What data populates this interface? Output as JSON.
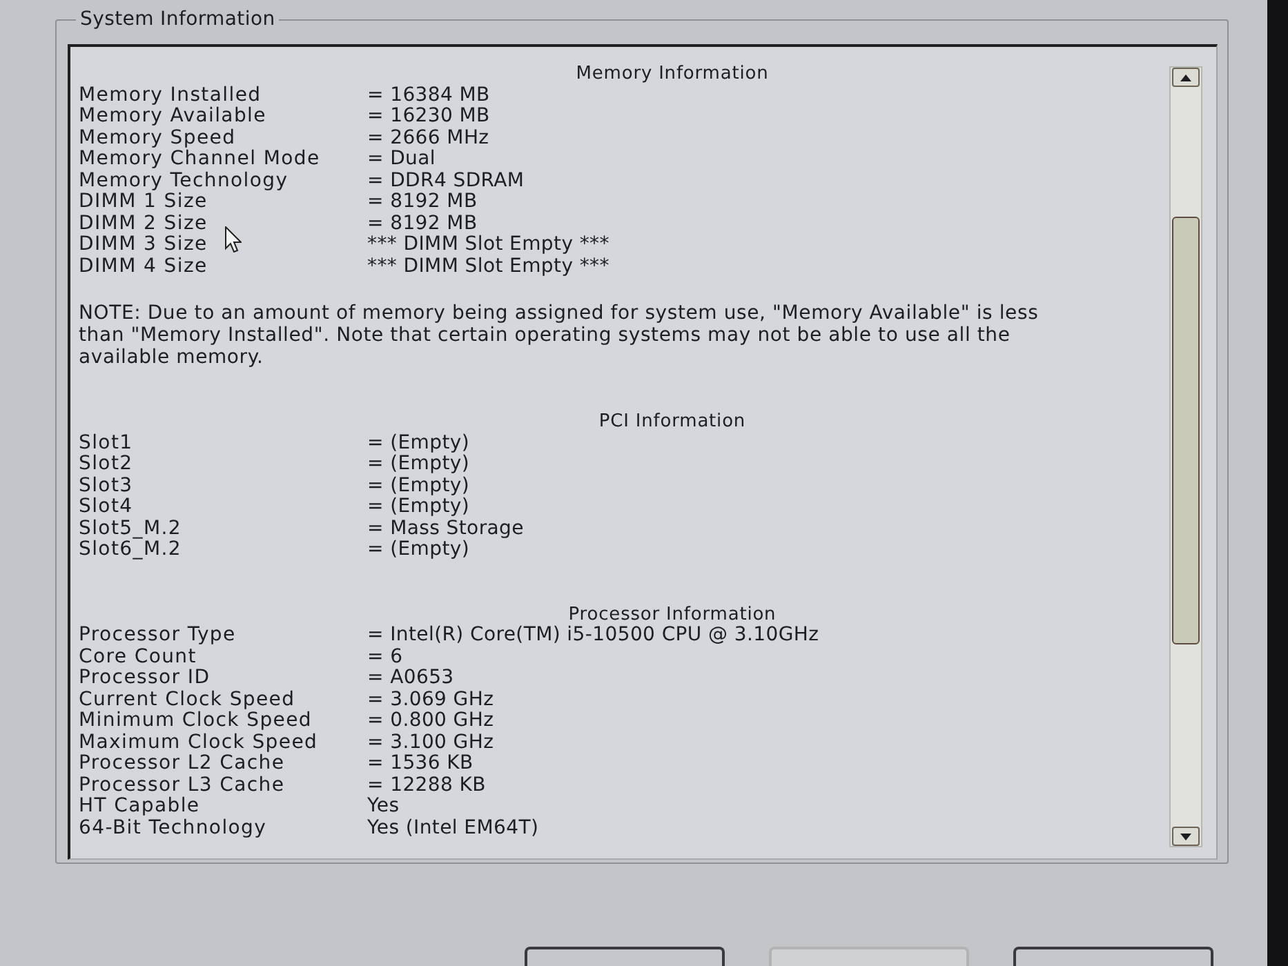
{
  "window": {
    "title": "System Information"
  },
  "sections": [
    {
      "title": "Memory Information",
      "rows": [
        {
          "label": "Memory Installed",
          "value": "= 16384 MB"
        },
        {
          "label": "Memory Available",
          "value": "= 16230 MB"
        },
        {
          "label": "Memory Speed",
          "value": "= 2666 MHz"
        },
        {
          "label": "Memory Channel Mode",
          "value": "= Dual"
        },
        {
          "label": "Memory Technology",
          "value": "= DDR4 SDRAM"
        },
        {
          "label": "DIMM 1 Size",
          "value": "= 8192 MB"
        },
        {
          "label": "DIMM 2 Size",
          "value": "= 8192 MB"
        },
        {
          "label": "DIMM 3 Size",
          "value": "*** DIMM Slot Empty ***"
        },
        {
          "label": "DIMM 4 Size",
          "value": "*** DIMM Slot Empty ***"
        }
      ],
      "note": "NOTE: Due to an amount of memory being assigned for system use, \"Memory Available\" is less than \"Memory Installed\". Note that certain operating systems may not be able to use all the available memory."
    },
    {
      "title": "PCI Information",
      "rows": [
        {
          "label": "Slot1",
          "value": "= (Empty)"
        },
        {
          "label": "Slot2",
          "value": "= (Empty)"
        },
        {
          "label": "Slot3",
          "value": "= (Empty)"
        },
        {
          "label": "Slot4",
          "value": "= (Empty)"
        },
        {
          "label": "Slot5_M.2",
          "value": "= Mass Storage"
        },
        {
          "label": "Slot6_M.2",
          "value": "= (Empty)"
        }
      ]
    },
    {
      "title": "Processor Information",
      "rows": [
        {
          "label": "Processor Type",
          "value": "= Intel(R) Core(TM) i5-10500 CPU @ 3.10GHz"
        },
        {
          "label": "Core Count",
          "value": "= 6"
        },
        {
          "label": "Processor ID",
          "value": "= A0653"
        },
        {
          "label": "Current Clock Speed",
          "value": "= 3.069 GHz"
        },
        {
          "label": "Minimum Clock Speed",
          "value": "= 0.800 GHz"
        },
        {
          "label": "Maximum Clock Speed",
          "value": "= 3.100 GHz"
        },
        {
          "label": "Processor L2 Cache",
          "value": "= 1536 KB"
        },
        {
          "label": "Processor L3 Cache",
          "value": "= 12288 KB"
        },
        {
          "label": "HT Capable",
          "value": "Yes"
        },
        {
          "label": "64-Bit Technology",
          "value": "Yes (Intel EM64T)"
        }
      ]
    }
  ],
  "buttons": [
    {
      "disabled": false
    },
    {
      "disabled": true
    },
    {
      "disabled": false
    }
  ]
}
